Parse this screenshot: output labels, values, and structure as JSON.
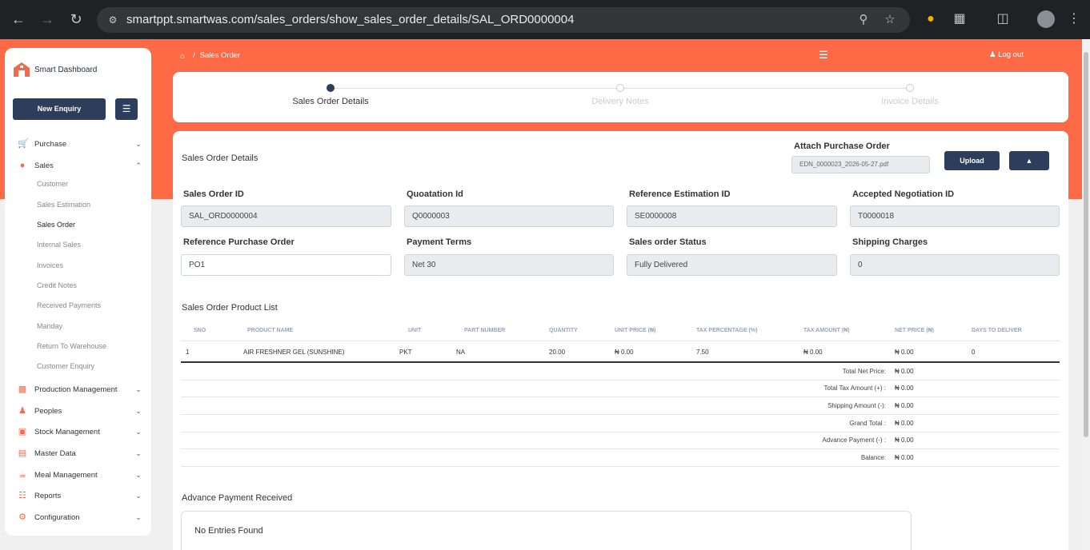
{
  "browser": {
    "url": "smartppt.smartwas.com/sales_orders/show_sales_order_details/SAL_ORD0000004"
  },
  "sidebar": {
    "brand": "Smart Dashboard",
    "new_enquiry": "New Enquiry",
    "menu": [
      {
        "label": "Purchase",
        "icon": "cart-icon"
      },
      {
        "label": "Sales",
        "icon": "sales-icon"
      },
      {
        "label": "Production Management",
        "icon": "factory-icon"
      },
      {
        "label": "Peoples",
        "icon": "people-icon"
      },
      {
        "label": "Stock Management",
        "icon": "box-icon"
      },
      {
        "label": "Master Data",
        "icon": "database-icon"
      },
      {
        "label": "Meal Management",
        "icon": "meal-icon"
      },
      {
        "label": "Reports",
        "icon": "report-icon"
      },
      {
        "label": "Configuration",
        "icon": "gear-icon"
      }
    ],
    "sales_sub": [
      "Customer",
      "Sales Estimation",
      "Sales Order",
      "Internal Sales",
      "Invoices",
      "Credit Notes",
      "Received Payments",
      "Manday",
      "Return To Warehouse",
      "Customer Enquiry"
    ]
  },
  "topbar": {
    "breadcrumb_sep": "/",
    "breadcrumb": "Sales Order",
    "logout": "Log out"
  },
  "stepper": {
    "steps": [
      "Sales Order Details",
      "Delivery Notes",
      "Invoice Details"
    ]
  },
  "main": {
    "title": "Sales Order Details",
    "attach_label": "Attach Purchase Order",
    "attach_file": "EDN_0000023_2026-05-27.pdf",
    "upload": "Upload",
    "download_glyph": "▲",
    "fields": [
      {
        "label": "Sales Order ID",
        "value": "SAL_ORD0000004"
      },
      {
        "label": "Quoatation Id",
        "value": "Q0000003"
      },
      {
        "label": "Reference Estimation ID",
        "value": "SE0000008"
      },
      {
        "label": "Accepted Negotiation ID",
        "value": "T0000018"
      },
      {
        "label": "Reference Purchase Order",
        "value": "PO1"
      },
      {
        "label": "Payment Terms",
        "value": "Net 30"
      },
      {
        "label": "Sales order Status",
        "value": "Fully Delivered"
      },
      {
        "label": "Shipping Charges",
        "value": "0"
      }
    ],
    "product_list_title": "Sales Order Product List",
    "columns": [
      "SNO",
      "PRODUCT NAME",
      "UNIT",
      "PART NUMBER",
      "QUANTITY",
      "UNIT PRICE (₦)",
      "TAX PERCENTAGE (%)",
      "TAX AMOUNT (₦)",
      "NET PRICE (₦)",
      "DAYS TO DELIVER"
    ],
    "rows": [
      [
        "1",
        "AIR FRESHNER GEL (SUNSHINE)",
        "PKT",
        "NA",
        "20.00",
        "₦ 0.00",
        "7.50",
        "₦ 0.00",
        "₦ 0.00",
        "0"
      ]
    ],
    "summary": [
      {
        "label": "Total Net Price:",
        "value": "₦ 0.00"
      },
      {
        "label": "Total Tax Amount (+) :",
        "value": "₦ 0.00"
      },
      {
        "label": "Shipping Amount (-):",
        "value": "₦ 0.00"
      },
      {
        "label": "Grand Total :",
        "value": "₦ 0.00"
      },
      {
        "label": "Advance Payment (-) :",
        "value": "₦ 0.00"
      },
      {
        "label": "Balance:",
        "value": "₦ 0.00"
      }
    ],
    "advance_title": "Advance Payment Received",
    "advance_empty": "No Entries Found"
  }
}
